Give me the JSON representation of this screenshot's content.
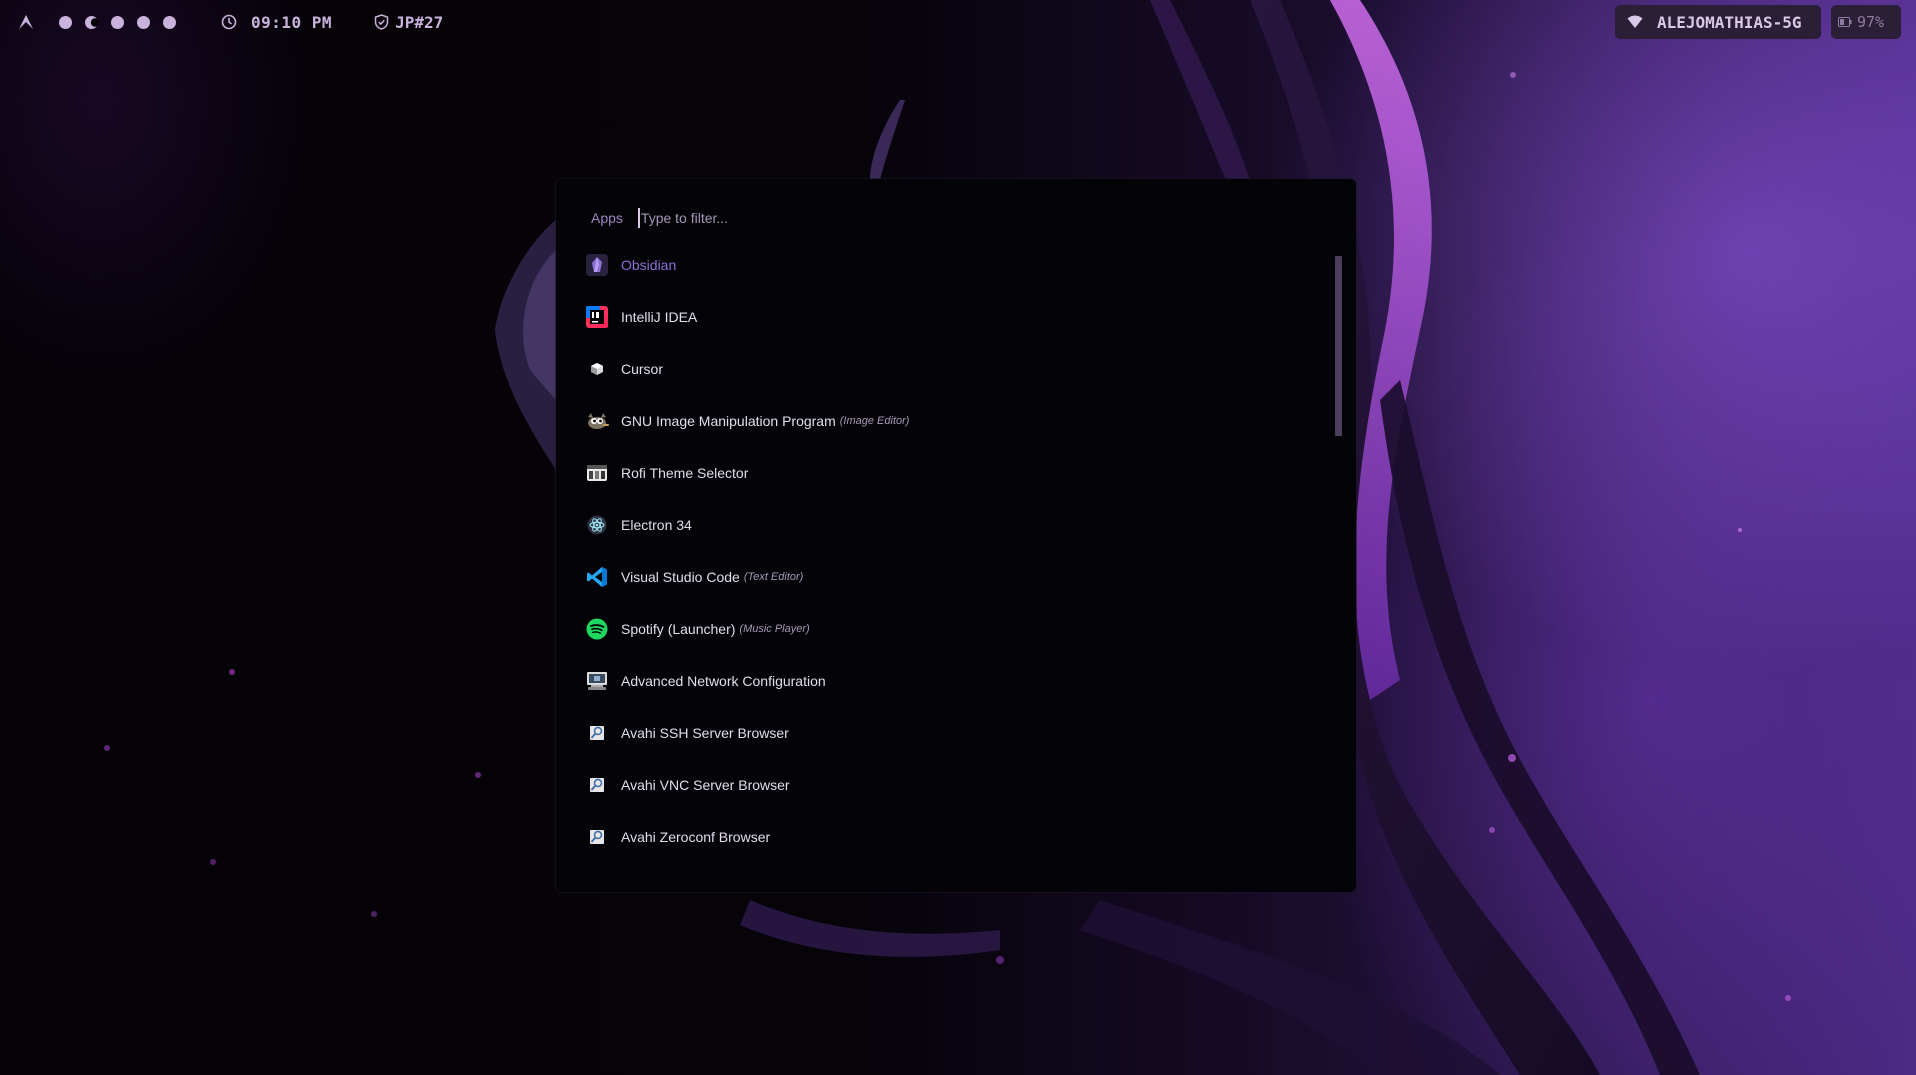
{
  "topbar": {
    "workspaces": [
      {
        "id": 1,
        "state": "active"
      },
      {
        "id": 2,
        "state": "urgent"
      },
      {
        "id": 3,
        "state": "normal"
      },
      {
        "id": 4,
        "state": "normal"
      },
      {
        "id": 5,
        "state": "normal"
      }
    ],
    "clock": "09:10 PM",
    "vpn": "JP#27",
    "wifi": "ALEJOMATHIAS-5G",
    "battery": "97%"
  },
  "launcher": {
    "mode_label": "Apps",
    "filter_placeholder": "Type to filter...",
    "filter_value": "",
    "selected_index": 0,
    "items": [
      {
        "name": "Obsidian",
        "comment": "",
        "icon": "obsidian-icon"
      },
      {
        "name": "IntelliJ IDEA",
        "comment": "",
        "icon": "intellij-icon"
      },
      {
        "name": "Cursor",
        "comment": "",
        "icon": "cursor-app-icon"
      },
      {
        "name": "GNU Image Manipulation Program",
        "comment": "(Image Editor)",
        "icon": "gimp-icon"
      },
      {
        "name": "Rofi Theme Selector",
        "comment": "",
        "icon": "rofi-theme-icon"
      },
      {
        "name": "Electron 34",
        "comment": "",
        "icon": "electron-icon"
      },
      {
        "name": "Visual Studio Code",
        "comment": "(Text Editor)",
        "icon": "vscode-icon"
      },
      {
        "name": "Spotify (Launcher)",
        "comment": "(Music Player)",
        "icon": "spotify-icon"
      },
      {
        "name": "Advanced Network Configuration",
        "comment": "",
        "icon": "network-config-icon"
      },
      {
        "name": "Avahi SSH Server Browser",
        "comment": "",
        "icon": "avahi-icon"
      },
      {
        "name": "Avahi VNC Server Browser",
        "comment": "",
        "icon": "avahi-icon"
      },
      {
        "name": "Avahi Zeroconf Browser",
        "comment": "",
        "icon": "avahi-icon"
      }
    ]
  },
  "colors": {
    "accent": "#8f6fd6",
    "bar_text": "#c9b3dc",
    "pill_bg": "#2a1f36",
    "launcher_bg": "#040307"
  }
}
